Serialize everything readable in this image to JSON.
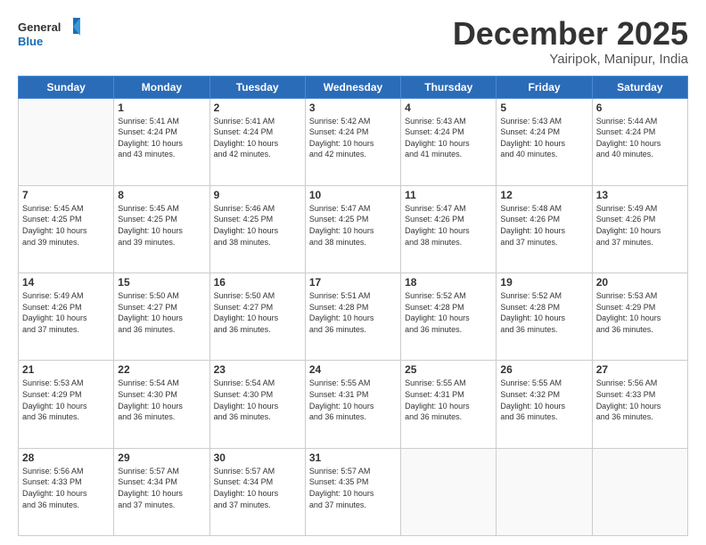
{
  "logo": {
    "line1": "General",
    "line2": "Blue"
  },
  "title": "December 2025",
  "subtitle": "Yairipok, Manipur, India",
  "headers": [
    "Sunday",
    "Monday",
    "Tuesday",
    "Wednesday",
    "Thursday",
    "Friday",
    "Saturday"
  ],
  "weeks": [
    [
      {
        "day": "",
        "info": ""
      },
      {
        "day": "1",
        "info": "Sunrise: 5:41 AM\nSunset: 4:24 PM\nDaylight: 10 hours\nand 43 minutes."
      },
      {
        "day": "2",
        "info": "Sunrise: 5:41 AM\nSunset: 4:24 PM\nDaylight: 10 hours\nand 42 minutes."
      },
      {
        "day": "3",
        "info": "Sunrise: 5:42 AM\nSunset: 4:24 PM\nDaylight: 10 hours\nand 42 minutes."
      },
      {
        "day": "4",
        "info": "Sunrise: 5:43 AM\nSunset: 4:24 PM\nDaylight: 10 hours\nand 41 minutes."
      },
      {
        "day": "5",
        "info": "Sunrise: 5:43 AM\nSunset: 4:24 PM\nDaylight: 10 hours\nand 40 minutes."
      },
      {
        "day": "6",
        "info": "Sunrise: 5:44 AM\nSunset: 4:24 PM\nDaylight: 10 hours\nand 40 minutes."
      }
    ],
    [
      {
        "day": "7",
        "info": "Sunrise: 5:45 AM\nSunset: 4:25 PM\nDaylight: 10 hours\nand 39 minutes."
      },
      {
        "day": "8",
        "info": "Sunrise: 5:45 AM\nSunset: 4:25 PM\nDaylight: 10 hours\nand 39 minutes."
      },
      {
        "day": "9",
        "info": "Sunrise: 5:46 AM\nSunset: 4:25 PM\nDaylight: 10 hours\nand 38 minutes."
      },
      {
        "day": "10",
        "info": "Sunrise: 5:47 AM\nSunset: 4:25 PM\nDaylight: 10 hours\nand 38 minutes."
      },
      {
        "day": "11",
        "info": "Sunrise: 5:47 AM\nSunset: 4:26 PM\nDaylight: 10 hours\nand 38 minutes."
      },
      {
        "day": "12",
        "info": "Sunrise: 5:48 AM\nSunset: 4:26 PM\nDaylight: 10 hours\nand 37 minutes."
      },
      {
        "day": "13",
        "info": "Sunrise: 5:49 AM\nSunset: 4:26 PM\nDaylight: 10 hours\nand 37 minutes."
      }
    ],
    [
      {
        "day": "14",
        "info": "Sunrise: 5:49 AM\nSunset: 4:26 PM\nDaylight: 10 hours\nand 37 minutes."
      },
      {
        "day": "15",
        "info": "Sunrise: 5:50 AM\nSunset: 4:27 PM\nDaylight: 10 hours\nand 36 minutes."
      },
      {
        "day": "16",
        "info": "Sunrise: 5:50 AM\nSunset: 4:27 PM\nDaylight: 10 hours\nand 36 minutes."
      },
      {
        "day": "17",
        "info": "Sunrise: 5:51 AM\nSunset: 4:28 PM\nDaylight: 10 hours\nand 36 minutes."
      },
      {
        "day": "18",
        "info": "Sunrise: 5:52 AM\nSunset: 4:28 PM\nDaylight: 10 hours\nand 36 minutes."
      },
      {
        "day": "19",
        "info": "Sunrise: 5:52 AM\nSunset: 4:28 PM\nDaylight: 10 hours\nand 36 minutes."
      },
      {
        "day": "20",
        "info": "Sunrise: 5:53 AM\nSunset: 4:29 PM\nDaylight: 10 hours\nand 36 minutes."
      }
    ],
    [
      {
        "day": "21",
        "info": "Sunrise: 5:53 AM\nSunset: 4:29 PM\nDaylight: 10 hours\nand 36 minutes."
      },
      {
        "day": "22",
        "info": "Sunrise: 5:54 AM\nSunset: 4:30 PM\nDaylight: 10 hours\nand 36 minutes."
      },
      {
        "day": "23",
        "info": "Sunrise: 5:54 AM\nSunset: 4:30 PM\nDaylight: 10 hours\nand 36 minutes."
      },
      {
        "day": "24",
        "info": "Sunrise: 5:55 AM\nSunset: 4:31 PM\nDaylight: 10 hours\nand 36 minutes."
      },
      {
        "day": "25",
        "info": "Sunrise: 5:55 AM\nSunset: 4:31 PM\nDaylight: 10 hours\nand 36 minutes."
      },
      {
        "day": "26",
        "info": "Sunrise: 5:55 AM\nSunset: 4:32 PM\nDaylight: 10 hours\nand 36 minutes."
      },
      {
        "day": "27",
        "info": "Sunrise: 5:56 AM\nSunset: 4:33 PM\nDaylight: 10 hours\nand 36 minutes."
      }
    ],
    [
      {
        "day": "28",
        "info": "Sunrise: 5:56 AM\nSunset: 4:33 PM\nDaylight: 10 hours\nand 36 minutes."
      },
      {
        "day": "29",
        "info": "Sunrise: 5:57 AM\nSunset: 4:34 PM\nDaylight: 10 hours\nand 37 minutes."
      },
      {
        "day": "30",
        "info": "Sunrise: 5:57 AM\nSunset: 4:34 PM\nDaylight: 10 hours\nand 37 minutes."
      },
      {
        "day": "31",
        "info": "Sunrise: 5:57 AM\nSunset: 4:35 PM\nDaylight: 10 hours\nand 37 minutes."
      },
      {
        "day": "",
        "info": ""
      },
      {
        "day": "",
        "info": ""
      },
      {
        "day": "",
        "info": ""
      }
    ]
  ]
}
